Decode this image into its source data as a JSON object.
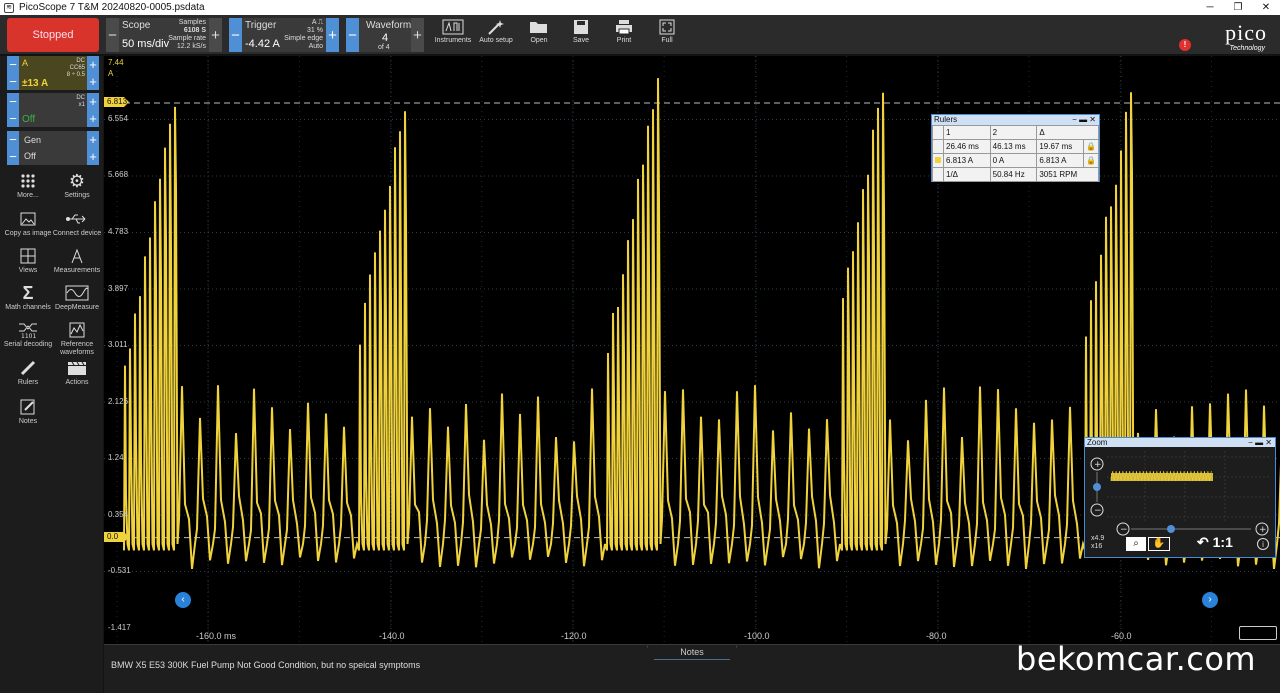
{
  "window": {
    "title": "PicoScope 7 T&M 20240820-0005.psdata"
  },
  "toolbar": {
    "stop_label": "Stopped",
    "scope": {
      "label": "Scope",
      "value": "50 ms/div",
      "samples_label": "Samples",
      "samples": "6108 S",
      "rate_label": "Sample rate",
      "rate": "12.2 kS/s"
    },
    "trigger": {
      "label": "Trigger",
      "value": "-4.42 A",
      "channel": "A",
      "percent": "31 %",
      "type": "Simple edge",
      "mode": "Auto"
    },
    "waveform": {
      "label": "Waveform",
      "value": "4",
      "of": "of 4"
    },
    "buttons": [
      {
        "label": "Instruments",
        "icon": "instruments-icon"
      },
      {
        "label": "Auto setup",
        "icon": "auto-setup-icon"
      },
      {
        "label": "Open",
        "icon": "folder-icon"
      },
      {
        "label": "Save",
        "icon": "save-icon"
      },
      {
        "label": "Print",
        "icon": "print-icon"
      },
      {
        "label": "Full",
        "icon": "fullscreen-icon"
      }
    ],
    "logo": {
      "brand": "pico",
      "tag": "Technology"
    },
    "alert_count": "!"
  },
  "channels": [
    {
      "name": "A",
      "coupling": "DC",
      "filter": "CC65",
      "probe": "8 ÷ 0.5",
      "range": "±13 A",
      "color": "#f0d23c"
    },
    {
      "name": "",
      "coupling": "DC",
      "probe": "x1",
      "range": "Off",
      "color": "#3fae49"
    },
    {
      "name": "Gen",
      "range": "Off"
    }
  ],
  "sidebar": [
    {
      "label": "More...",
      "icon": "more-icon"
    },
    {
      "label": "Settings",
      "icon": "gear-icon"
    },
    {
      "label": "Copy as image",
      "icon": "image-icon"
    },
    {
      "label": "Connect device",
      "icon": "usb-icon"
    },
    {
      "label": "Views",
      "icon": "grid-icon"
    },
    {
      "label": "Measurements",
      "icon": "measurements-icon"
    },
    {
      "label": "Math channels",
      "icon": "sigma-icon"
    },
    {
      "label": "DeepMeasure",
      "icon": "deepmeasure-icon"
    },
    {
      "label": "Serial decoding",
      "icon": "serial-icon"
    },
    {
      "label": "Reference waveforms",
      "icon": "reference-icon"
    },
    {
      "label": "Rulers",
      "icon": "ruler-icon"
    },
    {
      "label": "Actions",
      "icon": "clapper-icon"
    },
    {
      "label": "Notes",
      "icon": "notes-icon"
    }
  ],
  "plot": {
    "unit": "A",
    "y_ticks": [
      "7.44",
      "6.554",
      "5.668",
      "4.783",
      "3.897",
      "3.011",
      "2.126",
      "1.24",
      "0.354",
      "-0.531",
      "-1.417"
    ],
    "ruler_tag": "6.813",
    "zero_tag": "0.0",
    "x_ticks": [
      "-160.0 ms",
      "-140.0",
      "-120.0",
      "-100.0",
      "-80.0",
      "-60.0"
    ],
    "trace_color": "#f0d23c"
  },
  "rulers": {
    "title": "Rulers",
    "headers": [
      "1",
      "2",
      "Δ"
    ],
    "time": [
      "26.46 ms",
      "46.13 ms",
      "19.67 ms"
    ],
    "amp": [
      "6.813 A",
      "0 A",
      "6.813 A"
    ],
    "freq_label": "1/Δ",
    "freq": "50.84 Hz",
    "rpm": "3051 RPM"
  },
  "zoom": {
    "title": "Zoom",
    "factor_x": "x4.9",
    "factor_y": "x16",
    "ratio": "1:1"
  },
  "notes": {
    "tab": "Notes",
    "text": "BMW X5 E53 300K Fuel Pump Not Good Condition, but no speical symptoms"
  },
  "watermark": "bekomcar.com"
}
